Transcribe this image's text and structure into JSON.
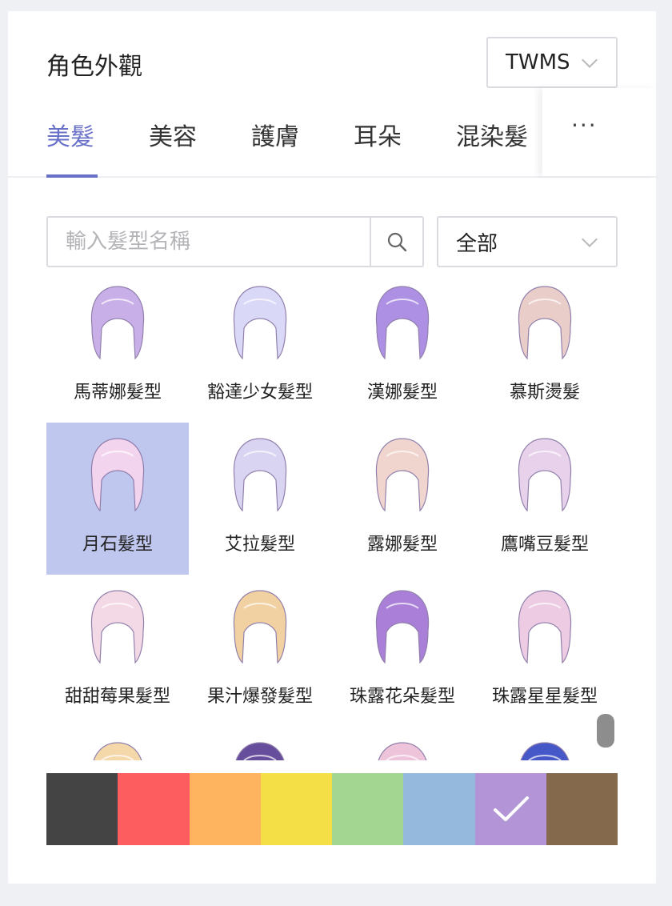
{
  "header": {
    "title": "角色外觀",
    "region": "TWMS"
  },
  "tabs": [
    {
      "label": "美髮",
      "active": true
    },
    {
      "label": "美容",
      "active": false
    },
    {
      "label": "護膚",
      "active": false
    },
    {
      "label": "耳朵",
      "active": false
    },
    {
      "label": "混染髮",
      "active": false
    }
  ],
  "tabs_more": "···",
  "search": {
    "placeholder": "輸入髮型名稱",
    "value": ""
  },
  "filter": {
    "selected": "全部"
  },
  "hairstyles": [
    {
      "name": "馬蒂娜髮型",
      "hair_color": "#c6abe6",
      "selected": false
    },
    {
      "name": "豁達少女髮型",
      "hair_color": "#d9d6f7",
      "selected": false
    },
    {
      "name": "漢娜髮型",
      "hair_color": "#a98be3",
      "selected": false
    },
    {
      "name": "慕斯燙髮",
      "hair_color": "#e8cbc6",
      "selected": false
    },
    {
      "name": "月石髮型",
      "hair_color": "#f6d5ee",
      "selected": true
    },
    {
      "name": "艾拉髮型",
      "hair_color": "#d8d2f1",
      "selected": false
    },
    {
      "name": "露娜髮型",
      "hair_color": "#f0d2cc",
      "selected": false
    },
    {
      "name": "鷹嘴豆髮型",
      "hair_color": "#e7cfea",
      "selected": false
    },
    {
      "name": "甜甜莓果髮型",
      "hair_color": "#f3d8e4",
      "selected": false
    },
    {
      "name": "果汁爆發髮型",
      "hair_color": "#f1cf9c",
      "selected": false
    },
    {
      "name": "珠露花朵髮型",
      "hair_color": "#a679d6",
      "selected": false
    },
    {
      "name": "珠露星星髮型",
      "hair_color": "#ecc9e2",
      "selected": false
    },
    {
      "name": "",
      "hair_color": "#f5d6a6",
      "selected": false
    },
    {
      "name": "",
      "hair_color": "#5f4597",
      "selected": false
    },
    {
      "name": "",
      "hair_color": "#eec1da",
      "selected": false
    },
    {
      "name": "",
      "hair_color": "#3d4fc5",
      "selected": false
    }
  ],
  "colors": [
    {
      "name": "black",
      "hex": "#444444",
      "selected": false
    },
    {
      "name": "red",
      "hex": "#fd5d5e",
      "selected": false
    },
    {
      "name": "orange",
      "hex": "#feb45f",
      "selected": false
    },
    {
      "name": "yellow",
      "hex": "#f5df47",
      "selected": false
    },
    {
      "name": "green",
      "hex": "#a3d691",
      "selected": false
    },
    {
      "name": "blue",
      "hex": "#94b9dc",
      "selected": false
    },
    {
      "name": "purple",
      "hex": "#b394d7",
      "selected": true
    },
    {
      "name": "brown",
      "hex": "#85694d",
      "selected": false
    }
  ],
  "theme": {
    "accent": "#6970c8",
    "selected_bg": "#c0c7ef"
  }
}
